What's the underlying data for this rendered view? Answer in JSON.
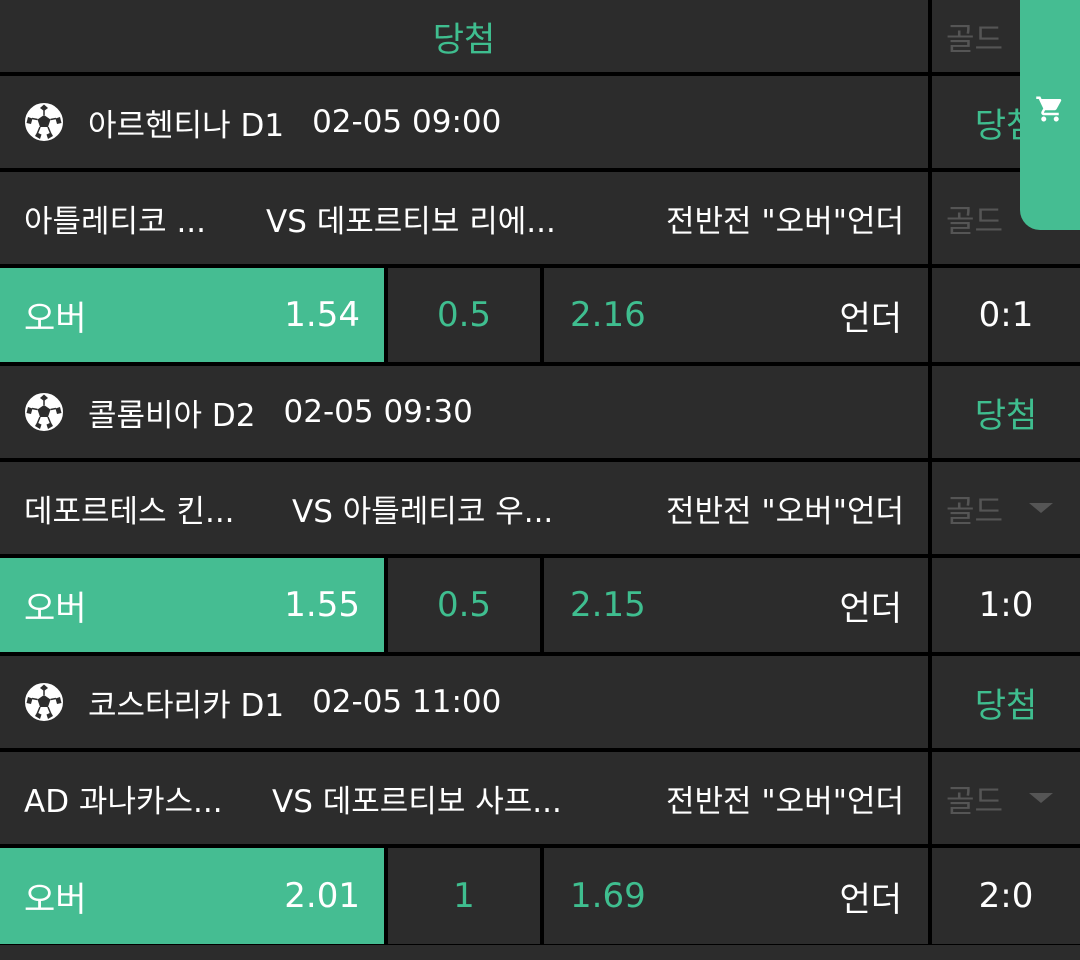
{
  "header": {
    "result_label": "당첨",
    "side_label": "골드"
  },
  "games": [
    {
      "league": "아르헨티나 D1",
      "datetime": "02-05 09:00",
      "status": "당첨",
      "home": "아틀레티코 ...",
      "vs_away": "VS 데포르티보 리에...",
      "market": "전반전 \"오버\"언더",
      "side_label": "골드",
      "over_label": "오버",
      "over_odds": "1.54",
      "line": "0.5",
      "under_odds": "2.16",
      "under_label": "언더",
      "score": "0:1"
    },
    {
      "league": "콜롬비아 D2",
      "datetime": "02-05 09:30",
      "status": "당첨",
      "home": "데포르테스 킨...",
      "vs_away": "VS 아틀레티코 우...",
      "market": "전반전 \"오버\"언더",
      "side_label": "골드",
      "over_label": "오버",
      "over_odds": "1.55",
      "line": "0.5",
      "under_odds": "2.15",
      "under_label": "언더",
      "score": "1:0"
    },
    {
      "league": "코스타리카 D1",
      "datetime": "02-05 11:00",
      "status": "당첨",
      "home": "AD 과나카스...",
      "vs_away": "VS 데포르티보 사프...",
      "market": "전반전 \"오버\"언더",
      "side_label": "골드",
      "over_label": "오버",
      "over_odds": "2.01",
      "line": "1",
      "under_odds": "1.69",
      "under_label": "언더",
      "score": "2:0"
    }
  ],
  "icons": {
    "sport": "soccer-ball-icon",
    "cart": "shopping-cart-icon",
    "dropdown": "caret-down-icon"
  },
  "colors": {
    "accent": "#45bd92",
    "accent_text": "#3fbe8f",
    "cell_bg": "#2c2c2c",
    "divider": "#000000",
    "muted": "#555555"
  }
}
